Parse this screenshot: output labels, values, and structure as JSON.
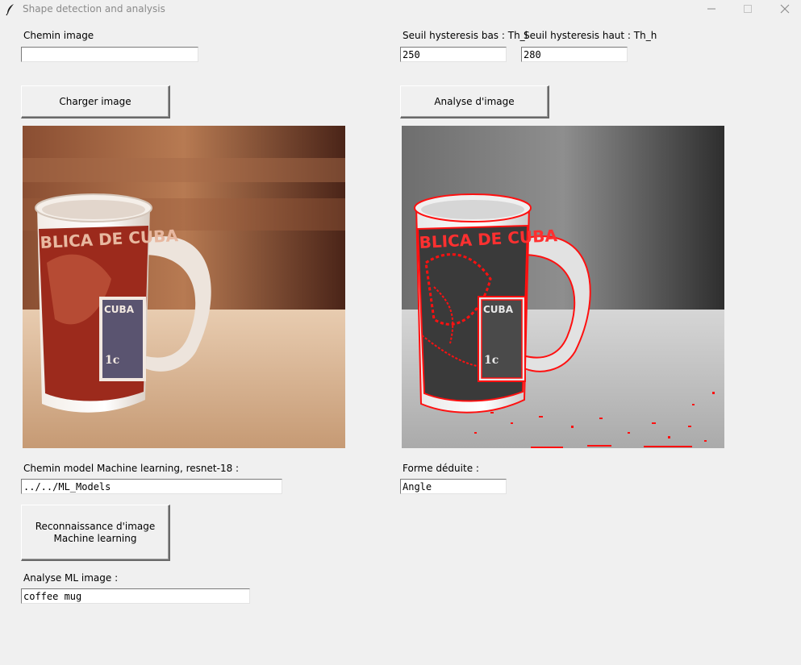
{
  "window": {
    "title": "Shape detection and analysis"
  },
  "left": {
    "path_label": "Chemin image",
    "path_value": "",
    "load_button": "Charger image",
    "ml_path_label": "Chemin model Machine learning, resnet-18 :",
    "ml_path_value": "../../ML_Models",
    "ml_button_line1": "Reconnaissance d'image",
    "ml_button_line2": "Machine learning",
    "ml_result_label": "Analyse ML image :",
    "ml_result_value": "coffee mug"
  },
  "right": {
    "th_low_label": "Seuil hysteresis bas : Th_l",
    "th_low_value": "250",
    "th_high_label": "Seuil hysteresis haut : Th_h",
    "th_high_value": "280",
    "analyze_button": "Analyse d'image",
    "shape_label": "Forme déduite :",
    "shape_value": "Angle"
  },
  "images": {
    "original_text": "BLICA DE CUBA",
    "stamp_text": "CUBA",
    "stamp_value": "1c"
  },
  "colors": {
    "edge": "#ff1010",
    "background": "#f0f0f0"
  }
}
